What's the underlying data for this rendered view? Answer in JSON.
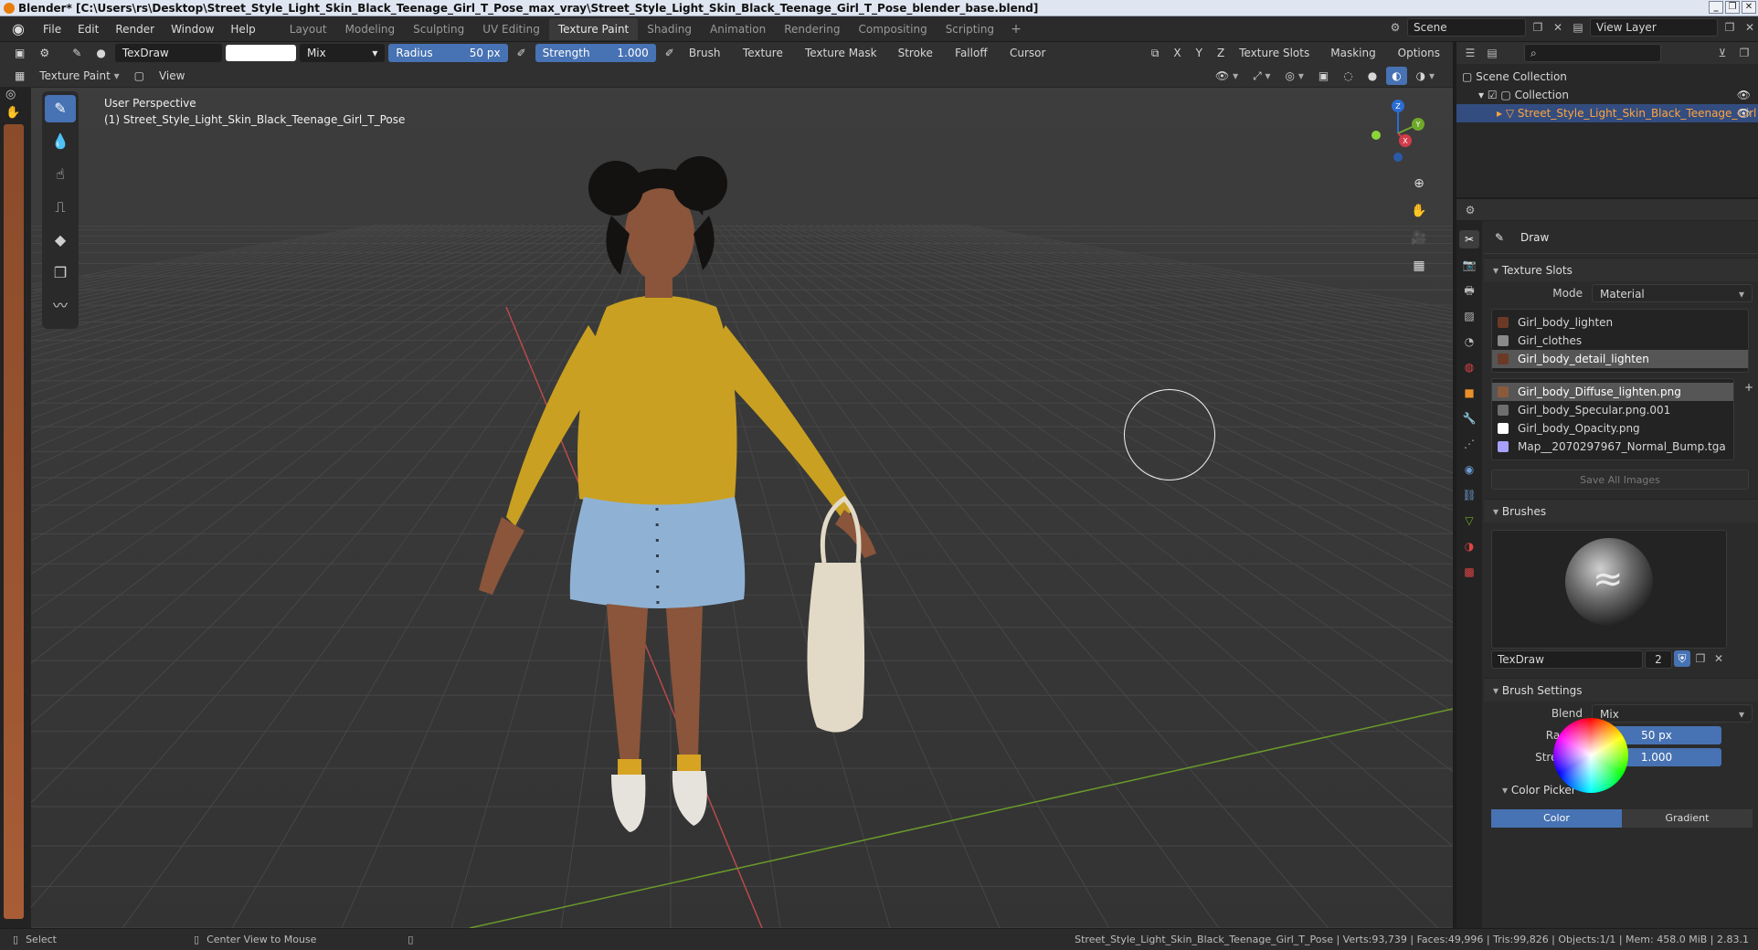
{
  "window": {
    "title": "Blender* [C:\\Users\\rs\\Desktop\\Street_Style_Light_Skin_Black_Teenage_Girl_T_Pose_max_vray\\Street_Style_Light_Skin_Black_Teenage_Girl_T_Pose_blender_base.blend]"
  },
  "menu": {
    "items": [
      "File",
      "Edit",
      "Render",
      "Window",
      "Help"
    ]
  },
  "workspaces": {
    "tabs": [
      "Layout",
      "Modeling",
      "Sculpting",
      "UV Editing",
      "Texture Paint",
      "Shading",
      "Animation",
      "Rendering",
      "Compositing",
      "Scripting"
    ],
    "active": "Texture Paint",
    "add": "+"
  },
  "scene": {
    "name": "Scene",
    "view_layer": "View Layer"
  },
  "tool_header": {
    "brush_name": "TexDraw",
    "color": "#ffffff",
    "blend": "Mix",
    "radius_label": "Radius",
    "radius_value": "50 px",
    "strength_label": "Strength",
    "strength_value": "1.000",
    "menus": [
      "Brush",
      "Texture",
      "Texture Mask",
      "Stroke",
      "Falloff",
      "Cursor"
    ],
    "axes": [
      "X",
      "Y",
      "Z"
    ],
    "right_menus": [
      "Texture Slots",
      "Masking",
      "Options"
    ]
  },
  "mode_header": {
    "mode": "Texture Paint",
    "view": "View"
  },
  "viewport": {
    "perspective": "User Perspective",
    "object": "(1) Street_Style_Light_Skin_Black_Teenage_Girl_T_Pose",
    "gizmo_axes": {
      "x": "X",
      "y": "Y",
      "z": "Z"
    }
  },
  "outliner": {
    "root": "Scene Collection",
    "collection": "Collection",
    "object": "Street_Style_Light_Skin_Black_Teenage_Girl"
  },
  "properties": {
    "tool_title": "Draw",
    "texture_slots": {
      "header": "Texture Slots",
      "mode_label": "Mode",
      "mode_value": "Material",
      "materials": [
        {
          "name": "Girl_body_lighten",
          "color": "#6b3a26"
        },
        {
          "name": "Girl_clothes",
          "color": "#8a8a8a"
        },
        {
          "name": "Girl_body_detail_lighten",
          "color": "#6b3a26"
        }
      ],
      "selected_material": 2,
      "images": [
        {
          "name": "Girl_body_Diffuse_lighten.png",
          "color": "#8a5a3c"
        },
        {
          "name": "Girl_body_Specular.png.001",
          "color": "#6e6e6e"
        },
        {
          "name": "Girl_body_Opacity.png",
          "color": "#ffffff"
        },
        {
          "name": "Map__2070297967_Normal_Bump.tga",
          "color": "#a8a0ff"
        }
      ],
      "selected_image": 0,
      "save_all": "Save All Images"
    },
    "brushes": {
      "header": "Brushes",
      "name": "TexDraw",
      "users": "2"
    },
    "brush_settings": {
      "header": "Brush Settings",
      "blend_label": "Blend",
      "blend_value": "Mix",
      "radius_label": "Radius",
      "radius_value": "50 px",
      "strength_label": "Strength",
      "strength_value": "1.000"
    },
    "color_picker": {
      "header": "Color Picker",
      "tab_color": "Color",
      "tab_gradient": "Gradient"
    }
  },
  "statusbar": {
    "select": "Select",
    "center_view": "Center View to Mouse",
    "stats": "Street_Style_Light_Skin_Black_Teenage_Girl_T_Pose | Verts:93,739 | Faces:49,996 | Tris:99,826 | Objects:1/1 | Mem: 458.0 MiB | 2.83.1"
  },
  "colors": {
    "accent": "#4772b3",
    "sweater": "#c9a021",
    "skirt": "#8fb2d4",
    "bag": "#e2dac7"
  }
}
